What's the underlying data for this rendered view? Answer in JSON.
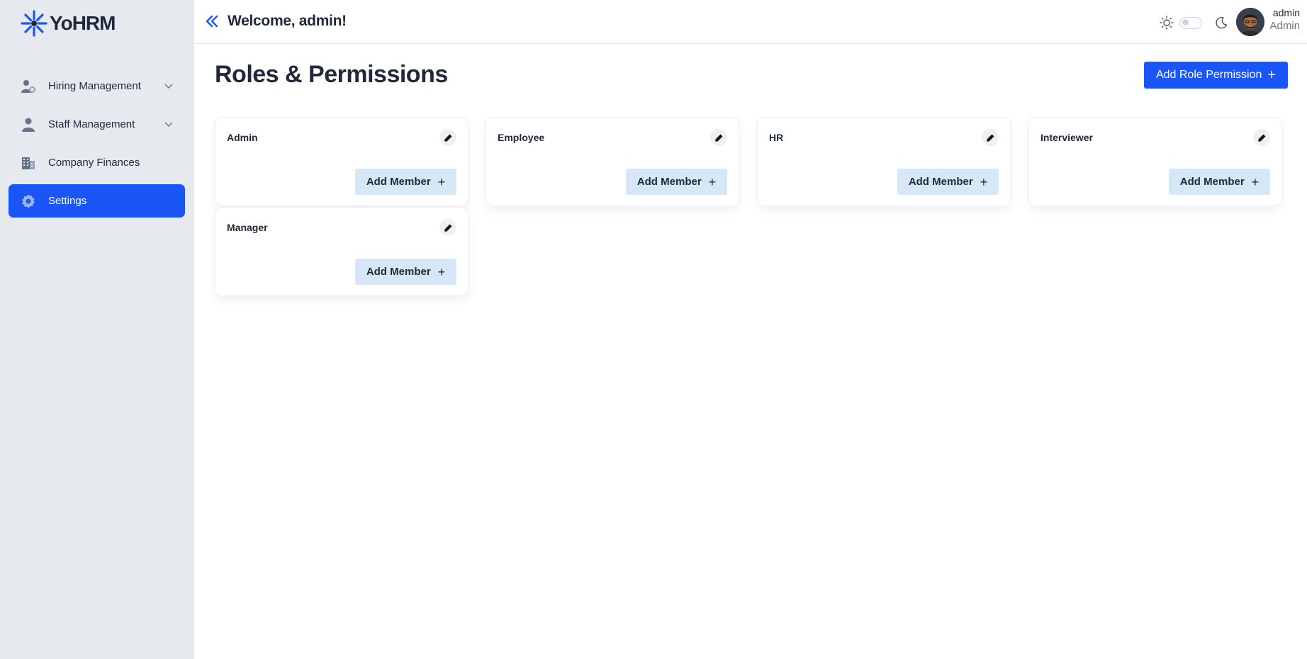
{
  "app": {
    "name": "YoHRM",
    "brand_color": "#1a56f5"
  },
  "sidebar": {
    "items": [
      {
        "label": "Hiring Management",
        "icon": "users-settings-icon",
        "has_chevron": true,
        "active": false
      },
      {
        "label": "Staff Management",
        "icon": "user-icon",
        "has_chevron": true,
        "active": false
      },
      {
        "label": "Company Finances",
        "icon": "building-icon",
        "has_chevron": false,
        "active": false
      },
      {
        "label": "Settings",
        "icon": "gear-icon",
        "has_chevron": false,
        "active": true
      }
    ]
  },
  "header": {
    "welcome": "Welcome, admin!",
    "user": {
      "name": "admin",
      "role": "Admin"
    }
  },
  "main": {
    "title": "Roles & Permissions",
    "add_role_label": "Add Role Permission",
    "add_member_label": "Add Member",
    "roles": [
      "Admin",
      "Employee",
      "HR",
      "Interviewer",
      "Manager"
    ]
  }
}
